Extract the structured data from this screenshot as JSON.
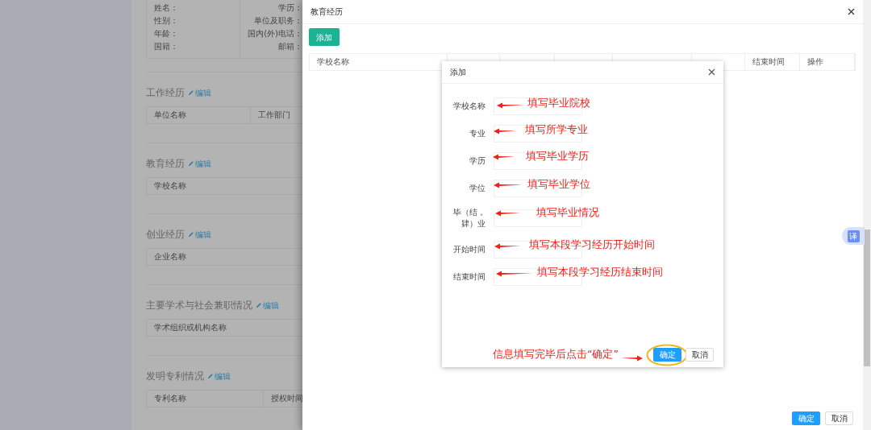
{
  "background_page": {
    "info_rows": [
      {
        "left_label": "姓名：",
        "right_label": "学历："
      },
      {
        "left_label": "性别：",
        "right_label": "单位及职务："
      },
      {
        "left_label": "年龄：",
        "right_label": "国内(外)电话："
      },
      {
        "left_label": "国籍：",
        "right_label": "邮箱："
      }
    ],
    "sections": [
      {
        "title": "工作经历",
        "edit_link": "编辑",
        "columns": [
          "单位名称",
          "工作部门"
        ]
      },
      {
        "title": "教育经历",
        "edit_link": "编辑",
        "columns": [
          "学校名称"
        ]
      },
      {
        "title": "创业经历",
        "edit_link": "编辑",
        "columns": [
          "企业名称"
        ]
      },
      {
        "title": "主要学术与社会兼职情况",
        "edit_link": "编辑",
        "columns": [
          "学术组织或机构名称"
        ]
      },
      {
        "title": "发明专利情况",
        "edit_link": "编辑",
        "columns": [
          "专利名称",
          "授权时间"
        ]
      }
    ]
  },
  "drawer": {
    "title": "教育经历",
    "add_button": "添加",
    "table": {
      "columns": [
        "学校名称",
        "结束时间",
        "操作"
      ]
    },
    "buttons": [
      {
        "label": "确定",
        "kind": "primary"
      },
      {
        "label": "取消",
        "kind": "default"
      }
    ]
  },
  "dialog": {
    "title": "添加",
    "fields": [
      {
        "label": "学校名称"
      },
      {
        "label": "专业"
      },
      {
        "label": "学历"
      },
      {
        "label": "学位"
      },
      {
        "label": "毕（结，肄）业"
      },
      {
        "label": "开始时间"
      },
      {
        "label": "结束时间"
      }
    ],
    "buttons": [
      {
        "label": "确定",
        "kind": "primary",
        "circled": true
      },
      {
        "label": "取消",
        "kind": "default",
        "circled": false
      }
    ]
  },
  "annotations": [
    {
      "text": "填写毕业院校",
      "kind": "left"
    },
    {
      "text": "填写所学专业",
      "kind": "left"
    },
    {
      "text": "填写毕业学历",
      "kind": "left"
    },
    {
      "text": "填写毕业学位",
      "kind": "left"
    },
    {
      "text": "填写毕业情况",
      "kind": "left"
    },
    {
      "text": "填写本段学习经历开始时间",
      "kind": "left"
    },
    {
      "text": "填写本段学习经历结束时间",
      "kind": "left"
    },
    {
      "text": "信息填写完毕后点击“确定”",
      "kind": "right"
    }
  ],
  "translate_badge": {
    "text": "译"
  }
}
